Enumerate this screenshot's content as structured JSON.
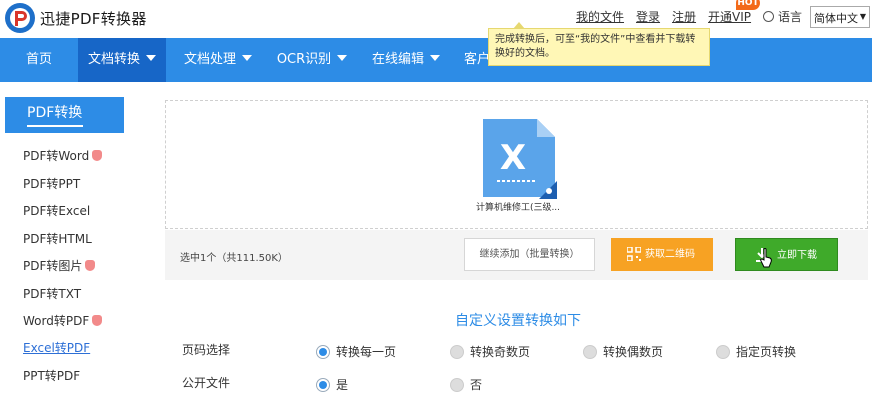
{
  "header": {
    "brand": "迅捷PDF转换器",
    "links": {
      "my_files": "我的文件",
      "login": "登录",
      "register": "注册",
      "vip": "开通VIP"
    },
    "hot_badge": "HOT",
    "language_label": "语言",
    "language_value": "简体中文"
  },
  "nav": {
    "items": [
      {
        "label": "首页",
        "has_caret": false
      },
      {
        "label": "文档转换",
        "has_caret": true
      },
      {
        "label": "文档处理",
        "has_caret": true
      },
      {
        "label": "OCR识别",
        "has_caret": true
      },
      {
        "label": "在线编辑",
        "has_caret": true
      },
      {
        "label": "客户"
      }
    ],
    "active_index": 1
  },
  "tooltip": {
    "text": "完成转换后，可至“我的文件”中查看并下载转换好的文档。"
  },
  "sidebar": {
    "title": "PDF转换",
    "items": [
      {
        "label": "PDF转Word",
        "hot": true
      },
      {
        "label": "PDF转PPT",
        "hot": false
      },
      {
        "label": "PDF转Excel",
        "hot": false
      },
      {
        "label": "PDF转HTML",
        "hot": false
      },
      {
        "label": "PDF转图片",
        "hot": true
      },
      {
        "label": "PDF转TXT",
        "hot": false
      },
      {
        "label": "Word转PDF",
        "hot": true
      },
      {
        "label": "Excel转PDF",
        "hot": false,
        "active": true
      },
      {
        "label": "PPT转PDF",
        "hot": false
      }
    ]
  },
  "upload": {
    "file_name": "计算机维修工(三级...",
    "status": "选中1个（共111.50K）",
    "continue_button": "继续添加（批量转换）",
    "qr_button": "获取二维码",
    "download_button": "立即下载"
  },
  "settings": {
    "title": "自定义设置转换如下",
    "page_label": "页码选择",
    "page_options": [
      "转换每一页",
      "转换奇数页",
      "转换偶数页",
      "指定页转换"
    ],
    "page_selected": 0,
    "public_label": "公开文件",
    "public_options": [
      "是",
      "否"
    ],
    "public_selected": 0
  },
  "colors": {
    "primary": "#2d8ce6",
    "nav_active": "#1766c7",
    "qr": "#f7a223",
    "download": "#3faa2a"
  }
}
